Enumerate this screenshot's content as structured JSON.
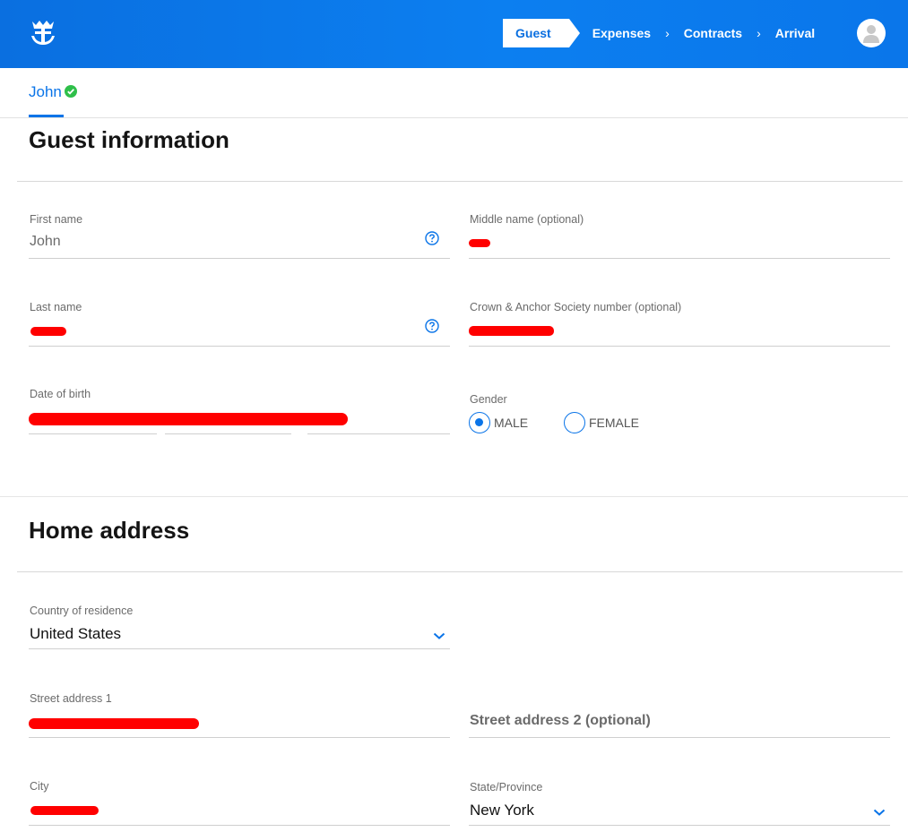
{
  "header": {
    "steps": [
      {
        "label": "Guest",
        "active": true
      },
      {
        "label": "Expenses",
        "active": false
      },
      {
        "label": "Contracts",
        "active": false
      },
      {
        "label": "Arrival",
        "active": false
      }
    ],
    "step_separator": "›",
    "brand_color": "#0a74e8",
    "logo_icon": "crown-anchor-logo-icon",
    "avatar_icon": "user-avatar-icon"
  },
  "guest_tab": {
    "label": "John",
    "status_icon": "check-circle-icon",
    "status_color": "#2fbf4a"
  },
  "guest_info": {
    "title": "Guest information",
    "first_name": {
      "label": "First name",
      "value": "John"
    },
    "middle_name": {
      "label": "Middle name (optional)",
      "value": ""
    },
    "last_name": {
      "label": "Last name",
      "value": ""
    },
    "crown_anchor": {
      "label": "Crown & Anchor Society number (optional)",
      "value": ""
    },
    "date_of_birth": {
      "label": "Date of birth",
      "value": ""
    },
    "gender": {
      "label": "Gender",
      "options": [
        {
          "label": "MALE",
          "selected": true
        },
        {
          "label": "FEMALE",
          "selected": false
        }
      ]
    }
  },
  "home_address": {
    "title": "Home address",
    "country": {
      "label": "Country of residence",
      "value": "United States"
    },
    "street1": {
      "label": "Street address 1",
      "value": ""
    },
    "street2": {
      "placeholder": "Street address 2 (optional)"
    },
    "city": {
      "label": "City",
      "value": ""
    },
    "state": {
      "label": "State/Province",
      "value": "New York"
    }
  }
}
